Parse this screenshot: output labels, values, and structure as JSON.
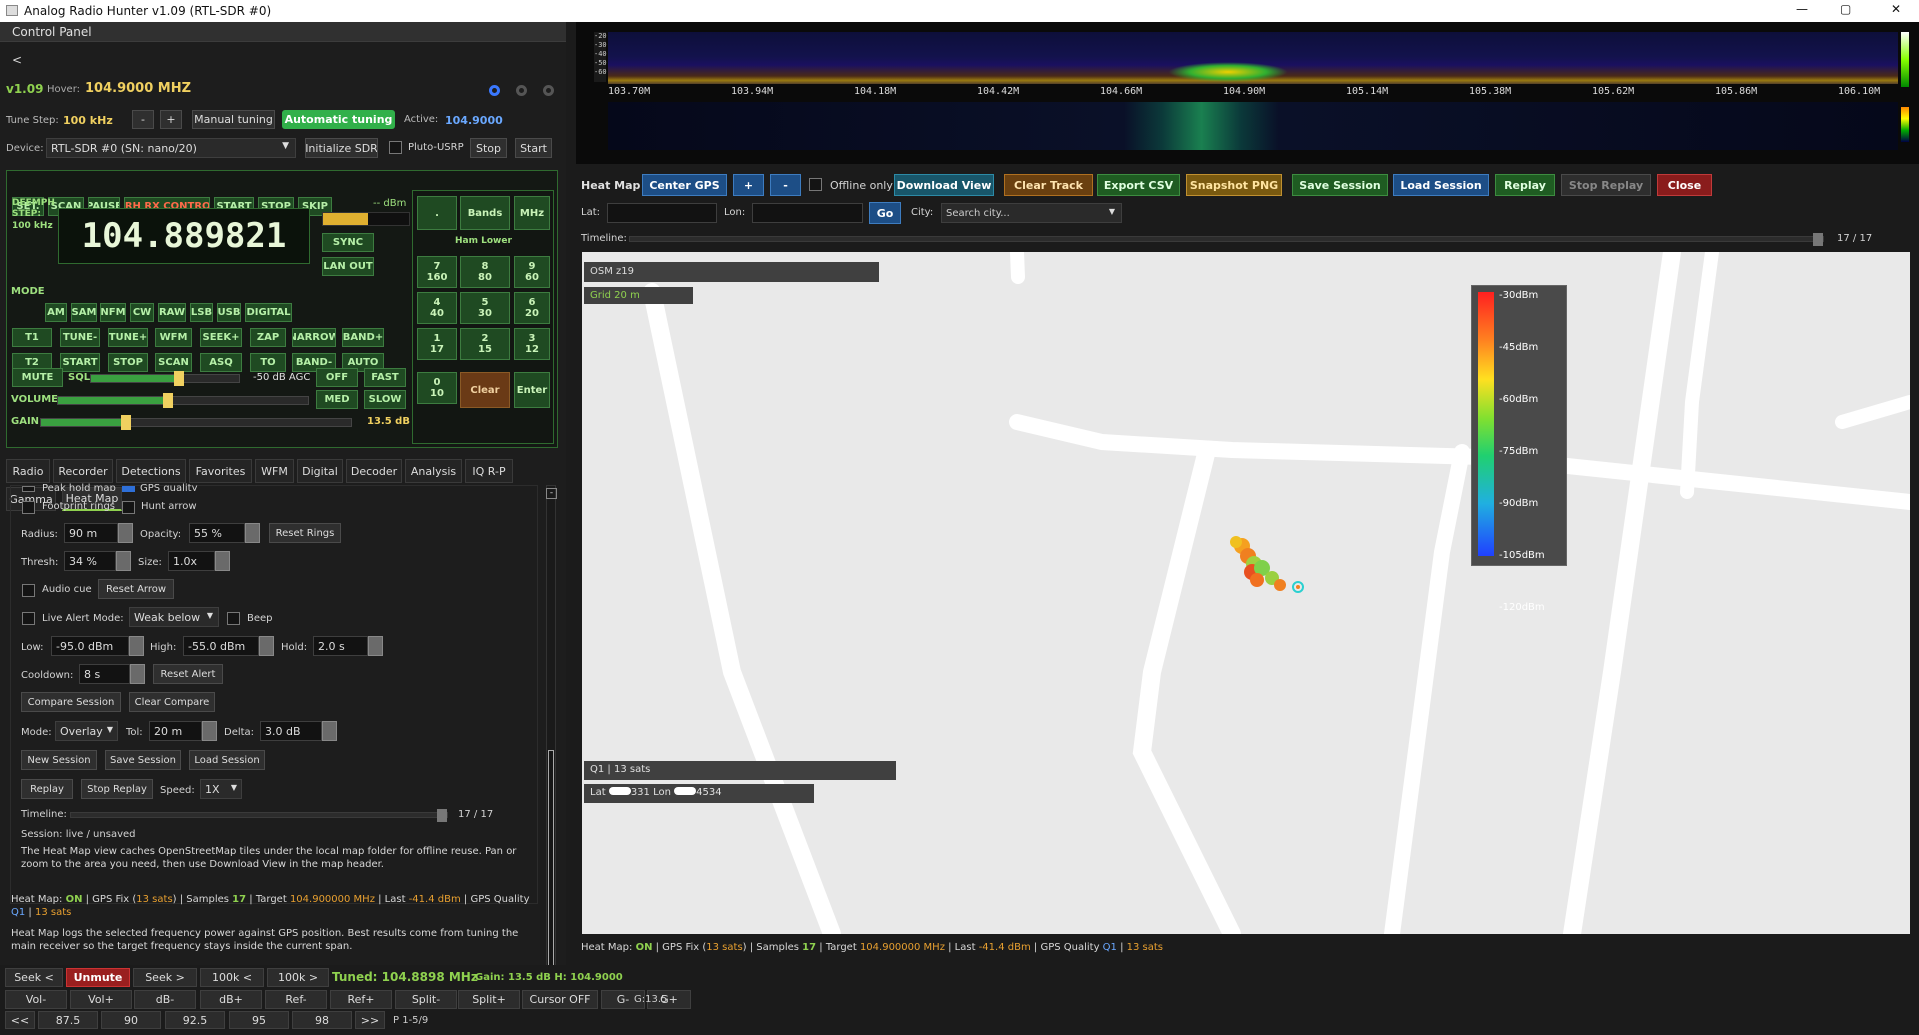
{
  "window": {
    "title": "Analog Radio Hunter v1.09 (RTL-SDR #0)",
    "min": "—",
    "max": "▢",
    "close": "✕"
  },
  "panel": {
    "title": "Control Panel",
    "collapse": "<",
    "version": "v1.09",
    "hover_label": "Hover:",
    "hover_value": "104.9000 MHZ",
    "tune_step_label": "Tune Step:",
    "tune_step": "100 kHz",
    "minus": "-",
    "plus": "+",
    "manual": "Manual tuning",
    "auto": "Automatic tuning",
    "active_label": "Active:",
    "active_value": "104.9000",
    "device_label": "Device:",
    "device_value": "RTL-SDR #0 (SN: nano/20)",
    "init": "Initialize SDR",
    "pluto": "Pluto-USRP",
    "stop": "Stop",
    "start": "Start"
  },
  "radio": {
    "top_buttons": [
      "SET.",
      "SCAN",
      "PAUSE",
      "ARH RX CONTROL",
      "START",
      "STOP",
      "SKIP"
    ],
    "deemph": "DEEMPH",
    "step": "STEP:",
    "step_val": "100 kHz",
    "dbm": "-- dBm",
    "freq": "104.889821",
    "sync": "SYNC",
    "lanout": "LAN OUT",
    "mode_label": "MODE",
    "modes": [
      "AM",
      "SAM",
      "NFM",
      "CW",
      "RAW",
      "LSB",
      "USB",
      "DIGITAL"
    ],
    "row1": [
      "T1",
      "TUNE-",
      "TUNE+",
      "WFM",
      "SEEK+",
      "ZAP",
      "NARROW",
      "BAND+"
    ],
    "row2": [
      "T2",
      "START",
      "STOP",
      "SCAN",
      "ASQ",
      "TO",
      "BAND-",
      "AUTO"
    ],
    "mute": "MUTE",
    "sql": "SQL",
    "agc": "-50 dB AGC",
    "off": "OFF",
    "fast": "FAST",
    "volume": "VOLUME",
    "med": "MED",
    "slow": "SLOW",
    "gain": "GAIN",
    "gain_val": "13.5 dB",
    "dot": ".",
    "bands": "Bands",
    "mhz": "MHz",
    "ham": "Ham Lower",
    "keys": [
      [
        "7",
        "160"
      ],
      [
        "8",
        "80"
      ],
      [
        "9",
        "60"
      ],
      [
        "4",
        "40"
      ],
      [
        "5",
        "30"
      ],
      [
        "6",
        "20"
      ],
      [
        "1",
        "17"
      ],
      [
        "2",
        "15"
      ],
      [
        "3",
        "12"
      ],
      [
        "0",
        "10"
      ]
    ],
    "clear": "Clear",
    "enter": "Enter"
  },
  "tabs": [
    "Radio",
    "Recorder",
    "Detections",
    "Favorites",
    "WFM",
    "Digital",
    "Decoder",
    "Analysis",
    "IQ R-P",
    "Gamma",
    "Heat Map"
  ],
  "settings": {
    "peak": "Peak hold map",
    "gps": "GPS quality",
    "footprint": "Footprint rings",
    "hunt": "Hunt arrow",
    "radius_l": "Radius:",
    "radius": "90 m",
    "opacity_l": "Opacity:",
    "opacity": "55 %",
    "reset_rings": "Reset Rings",
    "thresh_l": "Thresh:",
    "thresh": "34 %",
    "size_l": "Size:",
    "size": "1.0x",
    "audio": "Audio cue",
    "reset_arrow": "Reset Arrow",
    "live": "Live Alert",
    "mode_l": "Mode:",
    "mode": "Weak below",
    "beep": "Beep",
    "low_l": "Low:",
    "low": "-95.0 dBm",
    "high_l": "High:",
    "high": "-55.0 dBm",
    "hold_l": "Hold:",
    "hold": "2.0 s",
    "cool_l": "Cooldown:",
    "cool": "8 s",
    "reset_alert": "Reset Alert",
    "compare": "Compare Session",
    "clear_compare": "Clear Compare",
    "cmode_l": "Mode:",
    "cmode": "Overlay",
    "tol_l": "Tol:",
    "tol": "20 m",
    "delta_l": "Delta:",
    "delta": "3.0 dB",
    "new_s": "New Session",
    "save_s": "Save Session",
    "load_s": "Load Session",
    "replay": "Replay",
    "stop_replay": "Stop Replay",
    "speed_l": "Speed:",
    "speed": "1X",
    "timeline_l": "Timeline:",
    "timeline": "17 / 17",
    "session": "Session: live / unsaved",
    "note": "The Heat Map view caches OpenStreetMap tiles under the local map folder for offline reuse. Pan or zoom to the area you need, then use Download View in the map header."
  },
  "hmstatus": {
    "a": "Heat Map: ",
    "on": "ON",
    "b": " | GPS Fix (",
    "sats": "13 sats",
    "c": ") | Samples ",
    "samples": "17",
    "d": " | Target ",
    "target": "104.900000 MHz",
    "e": " | Last ",
    "last": "-41.4 dBm",
    "f": " | GPS Quality ",
    "q": "Q1",
    "g": " | ",
    "sats2": "13 sats"
  },
  "hmnote": "Heat Map logs the selected frequency power against GPS position. Best results come from tuning the main receiver so the target frequency stays inside the current span.",
  "bottom": {
    "seek_prev": "Seek <",
    "unmute": "Unmute",
    "seek_next": "Seek >",
    "k100p": "100k <",
    "k100n": "100k >",
    "tuned": "Tuned: 104.8898 MHz",
    "gainh": "Gain: 13.5 dB H: 104.9000",
    "row2": [
      "Vol-",
      "Vol+",
      "dB-",
      "dB+",
      "Ref-",
      "Ref+",
      "Split-",
      "Split+",
      "Cursor OFF",
      "G-",
      "G+"
    ],
    "g": "G:13.5",
    "row3": [
      "<<",
      "87.5",
      "90",
      "92.5",
      "95",
      "98",
      ">>"
    ],
    "page": "P 1-5/9"
  },
  "spectrum": {
    "ticks": [
      "103.70M",
      "103.94M",
      "104.18M",
      "104.42M",
      "104.66M",
      "104.90M",
      "105.14M",
      "105.38M",
      "105.62M",
      "105.86M",
      "106.10M"
    ],
    "scale": [
      "-20",
      "-30",
      "-40",
      "-50",
      "-60"
    ]
  },
  "heatmap": {
    "title": "Heat Map",
    "center": "Center GPS",
    "plus": "+",
    "minus": "-",
    "offline": "Offline only",
    "download": "Download View",
    "clear": "Clear Track",
    "export": "Export CSV",
    "snapshot": "Snapshot PNG",
    "save": "Save Session",
    "load": "Load Session",
    "replay": "Replay",
    "stop_replay": "Stop Replay",
    "close": "Close",
    "lat_l": "Lat:",
    "lon_l": "Lon:",
    "go": "Go",
    "city_l": "City:",
    "city_ph": "Search city...",
    "timeline_l": "Timeline:",
    "timeline": "17 / 17"
  },
  "map": {
    "osm": "OSM z19",
    "grid": "Grid 20 m",
    "q1": "Q1 | 13 sats",
    "lat": "Lat ",
    "lat_v": "331",
    "lon": "Lon ",
    "lon_v": "4534",
    "legend": [
      "-30dBm",
      "-45dBm",
      "-60dBm",
      "-75dBm",
      "-90dBm",
      "-105dBm",
      "-120dBm"
    ]
  },
  "colors": {
    "green": "#8fd14f",
    "orange": "#e8a030",
    "blue": "#6aa8ff",
    "cyan": "#39c3e0"
  }
}
